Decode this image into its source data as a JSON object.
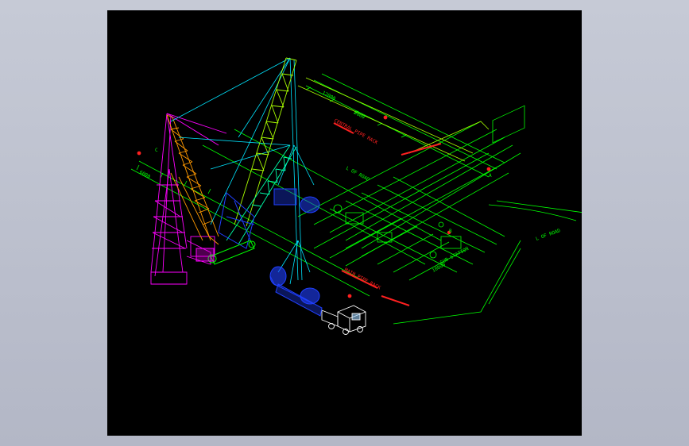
{
  "labels": {
    "road_left": "L OF ROAD",
    "road_right": "L OF ROAD",
    "area_upper": "CENTRAL PIPE RACK",
    "area_lower": "MAIN PIPE RACK",
    "area_mid": "SUB STATION",
    "dim_1": "12000",
    "dim_2": "8000",
    "dim_3": "6000",
    "dim_4": "10000",
    "axis_a": "A",
    "axis_b": "B",
    "axis_c": "C"
  },
  "colors": {
    "background": "#000000",
    "frame": "#b8bccb",
    "green": "#00ff00",
    "lime": "#aaff00",
    "cyan": "#00e5ff",
    "magenta": "#ff00ff",
    "orange": "#ff9900",
    "blue": "#2040ff",
    "red": "#ff2020",
    "white": "#ffffff"
  }
}
